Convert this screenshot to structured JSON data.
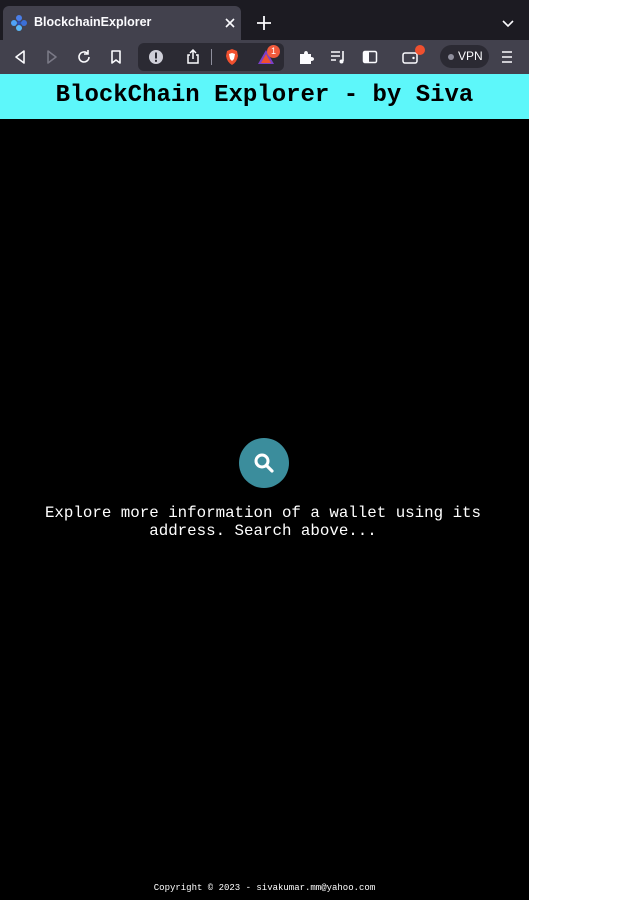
{
  "browser": {
    "tab": {
      "title": "BlockchainExplorer",
      "favicon": "blockchain-nodes-icon"
    },
    "toolbar": {
      "icons": [
        "back-icon",
        "forward-icon",
        "reload-icon",
        "bookmark-icon",
        "site-info-icon",
        "share-icon",
        "brave-shields-icon",
        "brave-rewards-icon",
        "extensions-icon",
        "playlist-icon",
        "sidebar-icon",
        "wallet-icon",
        "menu-icon"
      ],
      "rewards_badge": "1",
      "vpn_label": "VPN"
    }
  },
  "header": {
    "title": "BlockChain Explorer - by Siva"
  },
  "main": {
    "search_icon": "search-icon",
    "info_text": "Explore more information of a wallet using its address. Search above..."
  },
  "footer": {
    "copyright": "Copyright © 2023 - sivakumar.mm@yahoo.com"
  },
  "colors": {
    "header_bg": "#5df7fa",
    "search_circle": "#3b8d9c",
    "page_bg": "#000000",
    "browser_chrome": "#42414d",
    "tab_strip": "#1c1b22"
  }
}
